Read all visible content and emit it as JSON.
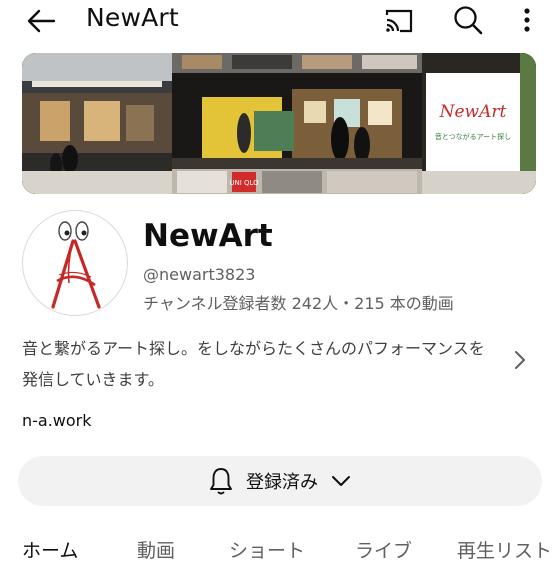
{
  "header": {
    "title": "NewArt"
  },
  "banner": {
    "logo_text": "NewArt",
    "tagline": "音とつながるアート探し",
    "shop_sign": "UNI QLO"
  },
  "channel": {
    "name": "NewArt",
    "handle": "@newart3823",
    "stats": "チャンネル登録者数 242人・215 本の動画",
    "description": "音と繋がるアート探し。をしながらたくさんのパフォーマンスを発信していきます。",
    "link": "n-a.work"
  },
  "subscribe": {
    "label": "登録済み"
  },
  "tabs": [
    {
      "label": "ホーム"
    },
    {
      "label": "動画"
    },
    {
      "label": "ショート"
    },
    {
      "label": "ライブ"
    },
    {
      "label": "再生リスト"
    }
  ],
  "icons": [
    "back-arrow-icon",
    "cast-icon",
    "search-icon",
    "more-vert-icon",
    "chevron-right-icon",
    "bell-icon",
    "chevron-down-icon"
  ]
}
